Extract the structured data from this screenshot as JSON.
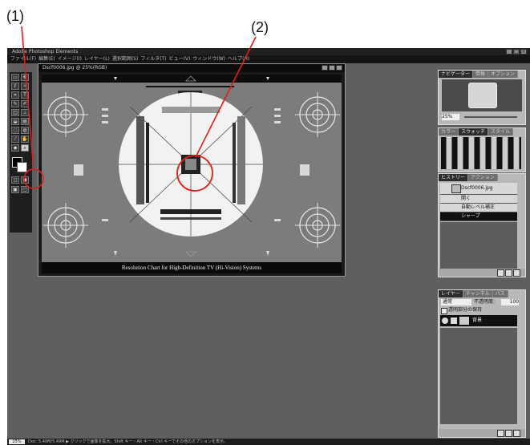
{
  "callouts": {
    "one": "(1)",
    "two": "(2)"
  },
  "app": {
    "title": "Adobe Photoshop Elements",
    "menus": [
      "ファイル(F)",
      "編集(E)",
      "イメージ(I)",
      "レイヤー(L)",
      "選択範囲(S)",
      "フィルタ(T)",
      "ビュー(V)",
      "ウィンドウ(W)",
      "ヘルプ(H)"
    ]
  },
  "document": {
    "title": "Dscf0006.jpg @ 25%(RGB)",
    "chart_caption": "Resolution Chart for High-Definition TV (Hi-Vision) Systems"
  },
  "navigator": {
    "tabs": [
      "ナビゲーター",
      "情報",
      "オプション"
    ],
    "zoom": "25%"
  },
  "swatches": {
    "tabs": [
      "カラー",
      "スウォッチ",
      "スタイル"
    ]
  },
  "history": {
    "tabs": [
      "ヒストリー",
      "アクション"
    ],
    "items": [
      "Dscf0006.jpg",
      "開く",
      "自動レベル補正",
      "シャープ"
    ]
  },
  "layers": {
    "tabs": [
      "レイヤー",
      "チャンネル",
      "パス"
    ],
    "mode": "通常",
    "opacity_label": "不透明度:",
    "opacity": "100",
    "preserve_label": "透明部分の保持",
    "layer_name": "背景"
  },
  "status": {
    "zoom": "25%",
    "text": "Doc: 5.49M/5.49M  ▶ クリックで画像を拡大。Shift キー・Alt キー・Ctrl キーでその他のオプションを表示。"
  },
  "colors": {
    "highlight_red": "#e01e1e",
    "workspace": "#5f5f5f"
  }
}
